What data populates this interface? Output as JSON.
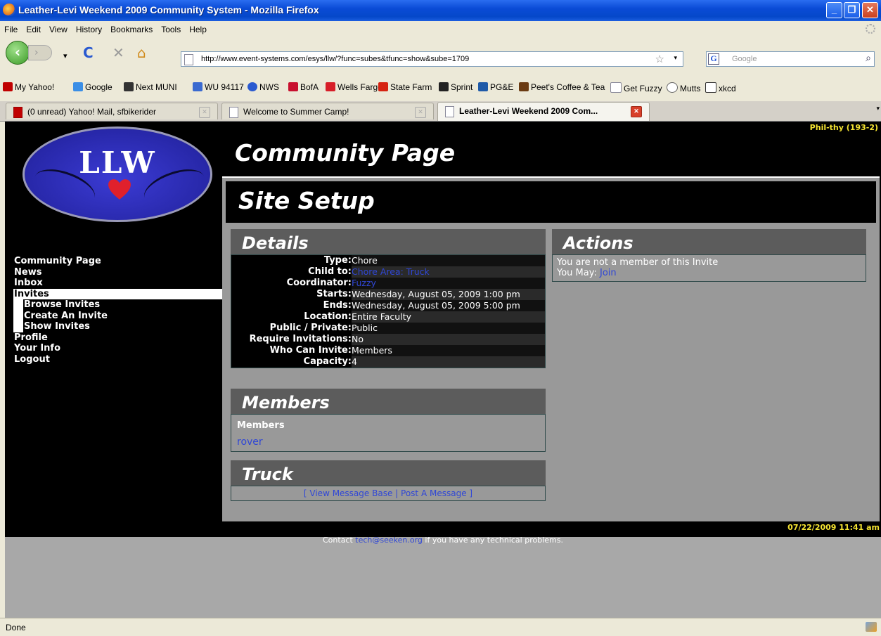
{
  "window": {
    "title": "Leather-Levi Weekend 2009 Community System - Mozilla Firefox",
    "buttons": [
      "_",
      "❐",
      "✕"
    ]
  },
  "menu": [
    "File",
    "Edit",
    "View",
    "History",
    "Bookmarks",
    "Tools",
    "Help"
  ],
  "nav": {
    "url": "http://www.event-systems.com/esys/llw/?func=subes&tfunc=show&sube=1709",
    "search_placeholder": "Google"
  },
  "bookmarks": [
    {
      "label": "My Yahoo!",
      "icon": "yahoo-icon",
      "color": "#c00000"
    },
    {
      "label": "Google",
      "icon": "google-icon",
      "color": "#3a8ee6"
    },
    {
      "label": "Next MUNI",
      "icon": "muni-icon",
      "color": "#333333"
    },
    {
      "label": "WU 94117",
      "icon": "weather-underground-icon",
      "color": "#3a6ad0"
    },
    {
      "label": "NWS",
      "icon": "nws-icon",
      "color": "#2a5ad0"
    },
    {
      "label": "BofA",
      "icon": "bofa-icon",
      "color": "#c8102e"
    },
    {
      "label": "Wells Fargo",
      "icon": "wells-fargo-icon",
      "color": "#d71e28"
    },
    {
      "label": "State Farm",
      "icon": "state-farm-icon",
      "color": "#d62311"
    },
    {
      "label": "Sprint",
      "icon": "sprint-icon",
      "color": "#222222"
    },
    {
      "label": "PG&E",
      "icon": "pge-icon",
      "color": "#1f5aa8"
    },
    {
      "label": "Peet's Coffee & Tea",
      "icon": "peets-icon",
      "color": "#6b3b12"
    },
    {
      "label": "Get Fuzzy",
      "icon": "page-icon",
      "color": "#ffffff"
    },
    {
      "label": "Mutts",
      "icon": "mutts-icon",
      "color": "#ffffff"
    },
    {
      "label": "xkcd",
      "icon": "xkcd-icon",
      "color": "#ffffff"
    }
  ],
  "tabs": [
    {
      "label": "(0 unread) Yahoo! Mail, sfbikerider",
      "icon": "yahoo-icon"
    },
    {
      "label": "Welcome to Summer Camp!",
      "icon": "page-icon"
    },
    {
      "label": "Leather-Levi Weekend 2009 Com...",
      "icon": "page-icon",
      "active": true
    }
  ],
  "page": {
    "user": "Phil-thy (193-2)",
    "logo_text": "LLW",
    "title": "Community Page",
    "section_title": "Site Setup",
    "leftnav": {
      "community_page": "Community Page",
      "news": "News",
      "inbox": "Inbox",
      "invites": "Invites",
      "browse_invites": "Browse Invites",
      "create_invite": "Create An Invite",
      "show_invites": "Show Invites",
      "profile": "Profile",
      "your_info": "Your Info",
      "logout": "Logout"
    },
    "details": {
      "heading": "Details",
      "rows": [
        {
          "key": "Type:",
          "value": "Chore"
        },
        {
          "key": "Child to:",
          "value": "Chore Area: Truck",
          "link": true
        },
        {
          "key": "Coordinator:",
          "value": "Fuzzy",
          "link": true
        },
        {
          "key": "Starts:",
          "value": "Wednesday, August 05, 2009 1:00 pm"
        },
        {
          "key": "Ends:",
          "value": "Wednesday, August 05, 2009 5:00 pm"
        },
        {
          "key": "Location:",
          "value": "Entire Faculty"
        },
        {
          "key": "Public / Private:",
          "value": "Public"
        },
        {
          "key": "Require Invitations:",
          "value": "No"
        },
        {
          "key": "Who Can Invite:",
          "value": "Members"
        },
        {
          "key": "Capacity:",
          "value": "4"
        }
      ]
    },
    "actions": {
      "heading": "Actions",
      "line1": "You are not a member of this Invite",
      "may_label": "You May:",
      "join": "Join"
    },
    "members": {
      "heading": "Members",
      "subheading": "Members",
      "list": [
        "rover"
      ]
    },
    "truck": {
      "heading": "Truck",
      "open_bracket": "[",
      "view": "View Message Base",
      "sep": "|",
      "post": "Post A Message",
      "close_bracket": "]"
    },
    "datestamp": "07/22/2009 11:41 am",
    "contact_prefix": "Contact",
    "contact_email": "tech@seeken.org",
    "contact_suffix": "if you have any technical problems."
  },
  "status": "Done",
  "colors": {
    "link": "#3047d6",
    "user_yellow": "#f5e431",
    "panel_header": "#5c5c5c",
    "content_bg": "#999999"
  }
}
